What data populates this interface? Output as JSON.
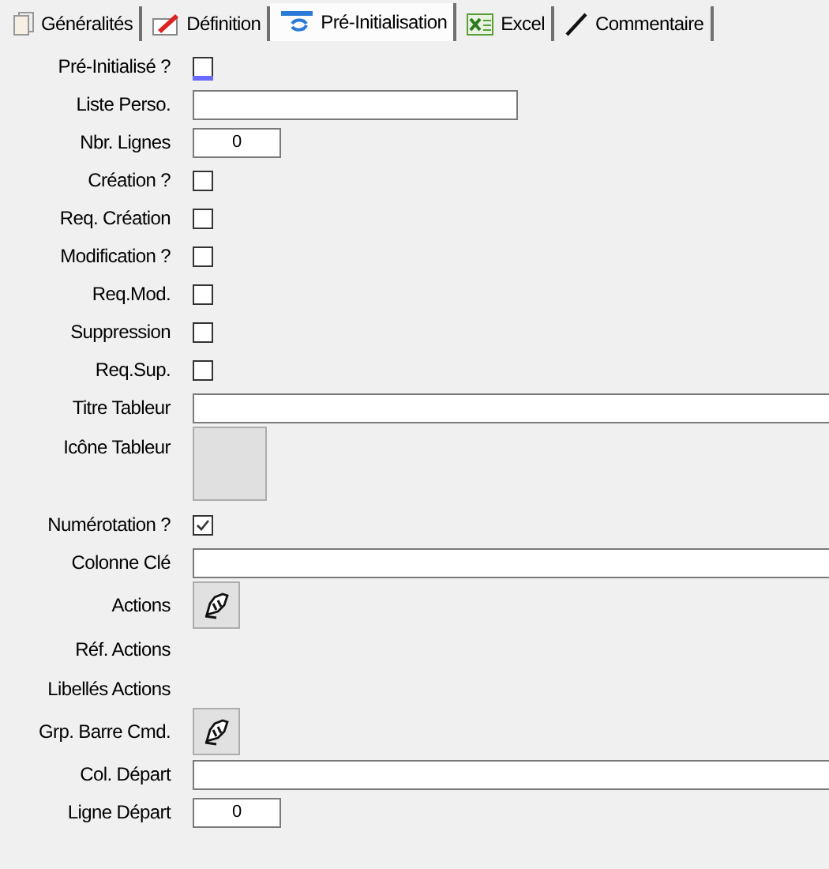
{
  "tabs": [
    {
      "label": "Généralités",
      "selected": false
    },
    {
      "label": "Définition",
      "selected": false
    },
    {
      "label": "Pré-Initialisation",
      "selected": true
    },
    {
      "label": "Excel",
      "selected": false
    },
    {
      "label": "Commentaire",
      "selected": false
    }
  ],
  "fields": [
    {
      "label": "Pré-Initialisé ?",
      "kind": "checkbox",
      "checked": false,
      "focused": true
    },
    {
      "label": "Liste Perso.",
      "kind": "list-field"
    },
    {
      "label": "Nbr. Lignes",
      "kind": "number-field",
      "value": "0"
    },
    {
      "label": "Création ?",
      "kind": "checkbox",
      "checked": false
    },
    {
      "label": "Req. Création",
      "kind": "checkbox",
      "checked": false
    },
    {
      "label": "Modification ?",
      "kind": "checkbox",
      "checked": false
    },
    {
      "label": "Req.Mod.",
      "kind": "checkbox",
      "checked": false
    },
    {
      "label": "Suppression",
      "kind": "checkbox",
      "checked": false
    },
    {
      "label": "Req.Sup.",
      "kind": "checkbox",
      "checked": false
    },
    {
      "label": "Titre Tableur",
      "kind": "wide-field"
    },
    {
      "label": "Icône Tableur",
      "kind": "image"
    },
    {
      "label": "Numérotation ?",
      "kind": "checkbox",
      "checked": true
    },
    {
      "label": "Colonne Clé",
      "kind": "wide-field"
    },
    {
      "label": "Actions",
      "kind": "button"
    },
    {
      "label": "Réf. Actions",
      "kind": "label"
    },
    {
      "label": "Libellés Actions",
      "kind": "label"
    },
    {
      "label": "Grp. Barre Cmd.",
      "kind": "button"
    },
    {
      "label": "Col. Départ",
      "kind": "wide-field"
    },
    {
      "label": "Ligne Départ",
      "kind": "number-field",
      "value": "0"
    }
  ]
}
